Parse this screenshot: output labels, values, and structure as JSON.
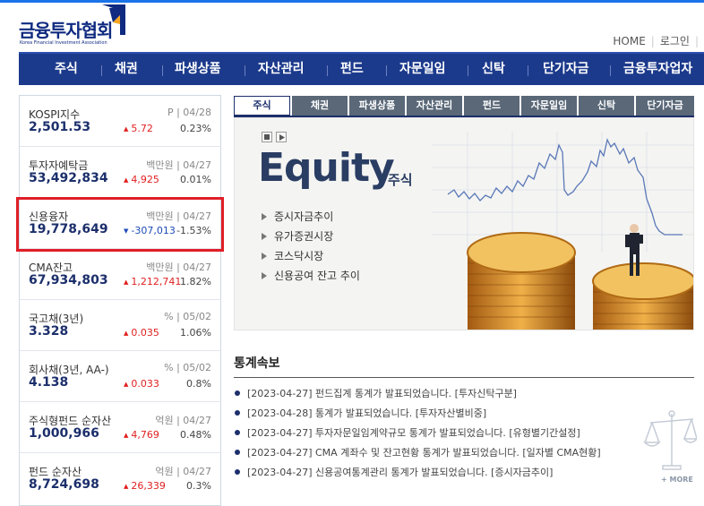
{
  "header": {
    "logo_text": "금융투자협회",
    "logo_sub": "Korea Financial Investment Association",
    "util_links": [
      "HOME",
      "로그인"
    ]
  },
  "gnb": [
    "주식",
    "채권",
    "파생상품",
    "자산관리",
    "펀드",
    "자문일임",
    "신탁",
    "단기자금",
    "금융투자업자"
  ],
  "stats": [
    {
      "name": "KOSPI지수",
      "unit": "P | 04/28",
      "value": "2,501.53",
      "change": "5.72",
      "dir": "up",
      "pct": "0.23%"
    },
    {
      "name": "투자자예탁금",
      "unit": "백만원 | 04/27",
      "value": "53,492,834",
      "change": "4,925",
      "dir": "up",
      "pct": "0.01%"
    },
    {
      "name": "신용융자",
      "unit": "백만원 | 04/27",
      "value": "19,778,649",
      "change": "-307,013",
      "dir": "down",
      "pct": "-1.53%"
    },
    {
      "name": "CMA잔고",
      "unit": "백만원 | 04/27",
      "value": "67,934,803",
      "change": "1,212,741",
      "dir": "up",
      "pct": "1.82%"
    },
    {
      "name": "국고채(3년)",
      "unit": "% | 05/02",
      "value": "3.328",
      "change": "0.035",
      "dir": "up",
      "pct": "1.06%"
    },
    {
      "name": "회사채(3년, AA-)",
      "unit": "% | 05/02",
      "value": "4.138",
      "change": "0.033",
      "dir": "up",
      "pct": "0.8%"
    },
    {
      "name": "주식형펀드 순자산",
      "unit": "억원 | 04/27",
      "value": "1,000,966",
      "change": "4,769",
      "dir": "up",
      "pct": "0.48%"
    },
    {
      "name": "펀드 순자산",
      "unit": "억원 | 04/27",
      "value": "8,724,698",
      "change": "26,339",
      "dir": "up",
      "pct": "0.3%"
    }
  ],
  "tabs": [
    "주식",
    "채권",
    "파생상품",
    "자산관리",
    "펀드",
    "자문일임",
    "신탁",
    "단기자금"
  ],
  "banner": {
    "title": "Equity",
    "subtitle": "주식",
    "links": [
      "증시자금추이",
      "유가증권시장",
      "코스닥시장",
      "신용공여 잔고 추이"
    ]
  },
  "news": {
    "title": "통계속보",
    "items": [
      "[2023-04-27] 펀드집계 통계가 발표되었습니다. [투자신탁구분]",
      "[2023-04-28] 통계가 발표되었습니다. [투자자산별비중]",
      "[2023-04-27] 투자자문일임계약규모 통계가 발표되었습니다. [유형별기간설정]",
      "[2023-04-27] CMA 계좌수 및 잔고현황 통계가 발표되었습니다. [일자별 CMA현황]",
      "[2023-04-27] 신용공여통계관리 통계가 발표되었습니다. [증시자금추이]"
    ],
    "more": "+ MORE"
  },
  "colors": {
    "navy": "#1c3a8c",
    "up": "#e02020",
    "down": "#1e4bb8",
    "highlight": "#e01e27"
  }
}
